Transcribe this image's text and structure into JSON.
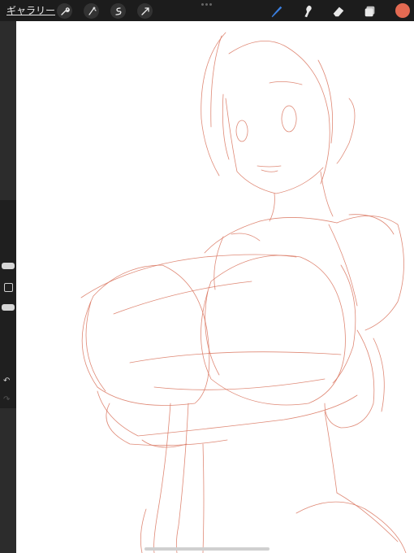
{
  "toolbar": {
    "gallery_label": "ギャラリー",
    "left_tools": [
      "wrench-icon",
      "magic-wand-icon",
      "selection-icon",
      "transform-arrow-icon"
    ],
    "right_tools": [
      "brush-icon",
      "smudge-icon",
      "eraser-icon",
      "layers-icon"
    ]
  },
  "colors": {
    "accent": "#e36a52",
    "brush_active": "#3a7fe0",
    "sketch": "#d9745e",
    "toolbar_bg": "#1c1c1c"
  },
  "sidebar": {
    "undo_icon": "undo-icon",
    "redo_icon": "redo-icon",
    "modify_icon": "square-modify-icon"
  }
}
